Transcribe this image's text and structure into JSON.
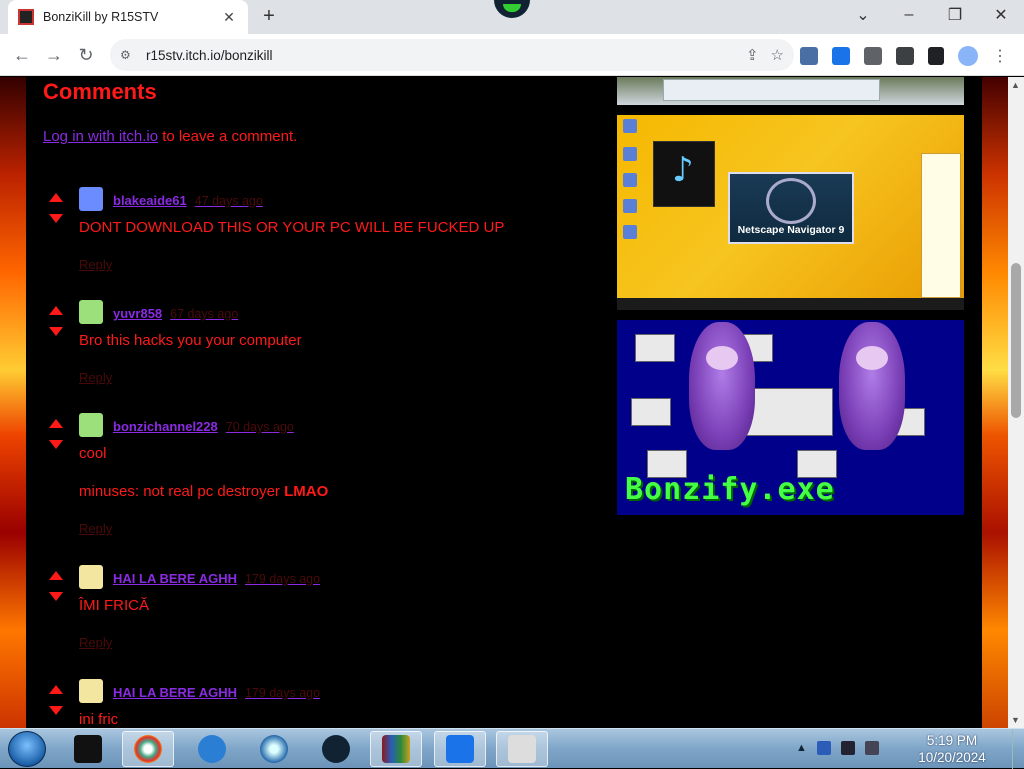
{
  "browser": {
    "tab_title": "BonziKill by R15STV",
    "url": "r15stv.itch.io/bonzikill",
    "tab_close": "✕",
    "new_tab": "+",
    "minimize": "⌄",
    "restore": "–",
    "maximize": "❐",
    "close": "✕"
  },
  "page": {
    "comments_heading": "Comments",
    "login_link": "Log in with itch.io",
    "login_suffix": " to leave a comment.",
    "reply_label": "Reply",
    "comments": [
      {
        "author": "blakeaide61",
        "date": "47 days ago",
        "body": "DONT DOWNLOAD THIS OR YOUR PC WILL BE FUCKED UP",
        "avatar_color": "#6b8cff"
      },
      {
        "author": "yuvr858",
        "date": "67 days ago",
        "body": "Bro this hacks you your computer",
        "avatar_color": "#9be07a"
      },
      {
        "author": "bonzichannel228",
        "date": "70 days ago",
        "body": "cool",
        "body2_prefix": "minuses:  not real pc destroyer ",
        "body2_bold": "LMAO",
        "avatar_color": "#9be07a"
      },
      {
        "author": "HAI LA BERE AGHH",
        "date": "179 days ago",
        "body": "ÎMI FRICĂ",
        "avatar_color": "#f2e6a0"
      },
      {
        "author": "HAI LA BERE AGHH",
        "date": "179 days ago",
        "body": "ini fric",
        "avatar_color": "#f2e6a0"
      }
    ],
    "screenshots": {
      "netscape_label": "Netscape Navigator 9",
      "bonzify_label": "Bonzify.exe"
    }
  },
  "taskbar": {
    "time": "5:19 PM",
    "date": "10/20/2024"
  },
  "colors": {
    "accent_red": "#ff1a1a",
    "link_purple": "#8a2be2"
  }
}
